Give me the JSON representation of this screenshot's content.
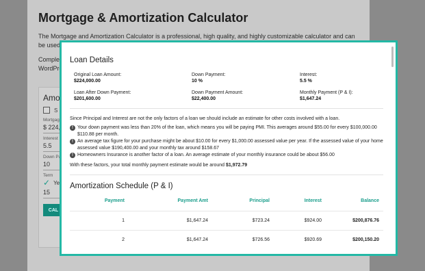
{
  "background": {
    "title": "Mortgage & Amortization Calculator",
    "intro_text": "The Mortgage and Amortization Calculator is a professional, high quality, and highly customizable calculator and can be used for Mortgage",
    "complete_text_1": "Complet",
    "complete_text_2": "WordPre",
    "calc": {
      "title": "Amor",
      "checkbox_label": "S",
      "fields": [
        {
          "label": "Mortgage",
          "value": "$ 224,0"
        },
        {
          "label": "Interest R",
          "value": "5.5"
        },
        {
          "label": "Down Pa",
          "value": "10"
        },
        {
          "label": "Term",
          "value": "Ye"
        },
        {
          "label": "",
          "value": "15"
        }
      ],
      "button_label": "CAL"
    }
  },
  "modal": {
    "loan_details_title": "Loan Details",
    "details": [
      {
        "label": "Original Loan Amount:",
        "value": "$224,000.00"
      },
      {
        "label": "Down Payment:",
        "value": "10 %"
      },
      {
        "label": "Interest:",
        "value": "5.5 %"
      },
      {
        "label": "Loan After Down Payment:",
        "value": "$201,600.00"
      },
      {
        "label": "Down Payment Amount:",
        "value": "$22,400.00"
      },
      {
        "label": "Monthly Payment (P & I):",
        "value": "$1,647.24"
      }
    ],
    "disclaimer": "Since Principal and Interest are not the only factors of a loan we should include an estimate for other costs involved with a loan.",
    "notes": [
      "Your down payment was less than 20% of the loan, which means you will be paying PMI. This averages around $55.00 for every $100,000.00 $110.88 per month.",
      "An average tax figure for your purchase might be about $10.00 for every $1,000.00 assessed value per year. If the assessed value of your home assessed value $190,400.00 and your monthly tax around $158.67",
      "Homeowners Insurance is another factor of a loan. An average estimate of your monthly insurance could be about $56.00"
    ],
    "total_prefix": "With these factors, your total monthly payment estimate would be around ",
    "total_value": "$1,972.79",
    "schedule_title": "Amortization Schedule (P & I)",
    "schedule_columns": [
      "Payment",
      "Payment Amt",
      "Principal",
      "Interest",
      "Balance"
    ],
    "schedule_rows": [
      [
        "1",
        "$1,647.24",
        "$723.24",
        "$924.00",
        "$200,876.76"
      ],
      [
        "2",
        "$1,647.24",
        "$726.56",
        "$920.69",
        "$200,150.20"
      ]
    ]
  },
  "colors": {
    "accent": "#23b8a5",
    "header_teal": "#1b9e8c"
  },
  "icons": {
    "info": "info-icon",
    "check": "check-icon"
  }
}
